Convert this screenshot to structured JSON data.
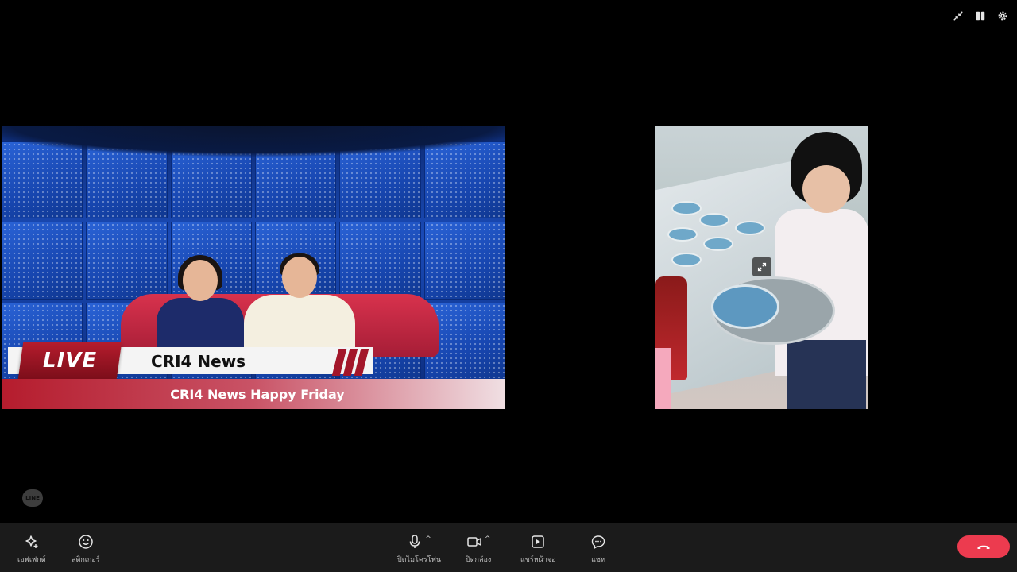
{
  "top_controls": {
    "icons": [
      "collapse-icon",
      "layout-icon",
      "settings-icon"
    ]
  },
  "left_tile": {
    "lower_third": {
      "live_label": "LIVE",
      "title": "CRI4 News",
      "subtitle": "CRI4 News Happy Friday"
    }
  },
  "right_tile": {
    "expand_icon": "expand-icon"
  },
  "watermark": {
    "logo_text": "LINE"
  },
  "toolbar": {
    "effects_label": "เอฟเฟกต์",
    "stickers_label": "สติกเกอร์",
    "mic_label": "ปิดไมโครโฟน",
    "camera_label": "ปิดกล้อง",
    "share_label": "แชร์หน้าจอ",
    "chat_label": "แชท",
    "caret": "^"
  },
  "colors": {
    "end_call": "#ec3b4f",
    "toolbar_bg": "#1b1b1b",
    "live_red": "#b51c2d"
  }
}
